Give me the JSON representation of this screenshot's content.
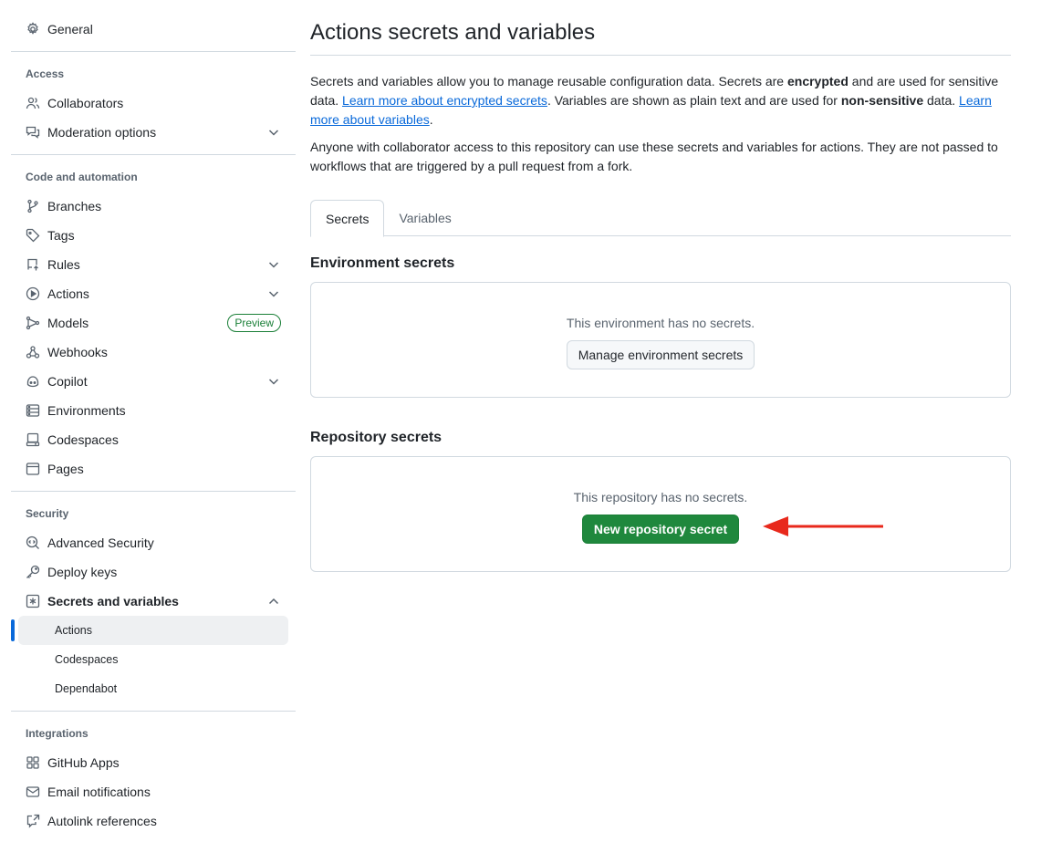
{
  "sidebar": {
    "general": {
      "label": "General",
      "icon": "gear-icon"
    },
    "groups": {
      "access": {
        "heading": "Access",
        "items": [
          {
            "label": "Collaborators",
            "icon": "people-icon"
          },
          {
            "label": "Moderation options",
            "icon": "comment-discussion-icon",
            "expandable": true
          }
        ]
      },
      "code_automation": {
        "heading": "Code and automation",
        "items": [
          {
            "label": "Branches",
            "icon": "git-branch-icon"
          },
          {
            "label": "Tags",
            "icon": "tag-icon"
          },
          {
            "label": "Rules",
            "icon": "repo-push-icon",
            "expandable": true
          },
          {
            "label": "Actions",
            "icon": "play-icon",
            "expandable": true
          },
          {
            "label": "Models",
            "icon": "models-icon",
            "badge": "Preview"
          },
          {
            "label": "Webhooks",
            "icon": "webhook-icon"
          },
          {
            "label": "Copilot",
            "icon": "copilot-icon",
            "expandable": true
          },
          {
            "label": "Environments",
            "icon": "server-icon"
          },
          {
            "label": "Codespaces",
            "icon": "codespaces-icon"
          },
          {
            "label": "Pages",
            "icon": "browser-icon"
          }
        ]
      },
      "security": {
        "heading": "Security",
        "items": [
          {
            "label": "Advanced Security",
            "icon": "codescan-icon"
          },
          {
            "label": "Deploy keys",
            "icon": "key-icon"
          },
          {
            "label": "Secrets and variables",
            "icon": "key-asterisk-icon",
            "expanded": true
          }
        ],
        "subitems": [
          {
            "label": "Actions",
            "active": true
          },
          {
            "label": "Codespaces"
          },
          {
            "label": "Dependabot"
          }
        ]
      },
      "integrations": {
        "heading": "Integrations",
        "items": [
          {
            "label": "GitHub Apps",
            "icon": "apps-icon"
          },
          {
            "label": "Email notifications",
            "icon": "mail-icon"
          },
          {
            "label": "Autolink references",
            "icon": "cross-reference-icon"
          }
        ]
      }
    }
  },
  "main": {
    "title": "Actions secrets and variables",
    "intro": {
      "p1_a": "Secrets and variables allow you to manage reusable configuration data. Secrets are ",
      "p1_b": "encrypted",
      "p1_c": " and are used for sensitive data. ",
      "p1_link1": "Learn more about encrypted secrets",
      "p1_d": ". Variables are shown as plain text and are used for ",
      "p1_e": "non-sensitive",
      "p1_f": " data. ",
      "p1_link2": "Learn more about variables",
      "p1_g": ".",
      "p2": "Anyone with collaborator access to this repository can use these secrets and variables for actions. They are not passed to workflows that are triggered by a pull request from a fork."
    },
    "tabs": [
      {
        "label": "Secrets",
        "selected": true
      },
      {
        "label": "Variables"
      }
    ],
    "environment_secrets": {
      "title": "Environment secrets",
      "empty_message": "This environment has no secrets.",
      "button": "Manage environment secrets"
    },
    "repository_secrets": {
      "title": "Repository secrets",
      "empty_message": "This repository has no secrets.",
      "button": "New repository secret"
    }
  },
  "colors": {
    "accent": "#0969da",
    "primary_button": "#1f883d",
    "annotation_arrow": "#e8291c"
  }
}
